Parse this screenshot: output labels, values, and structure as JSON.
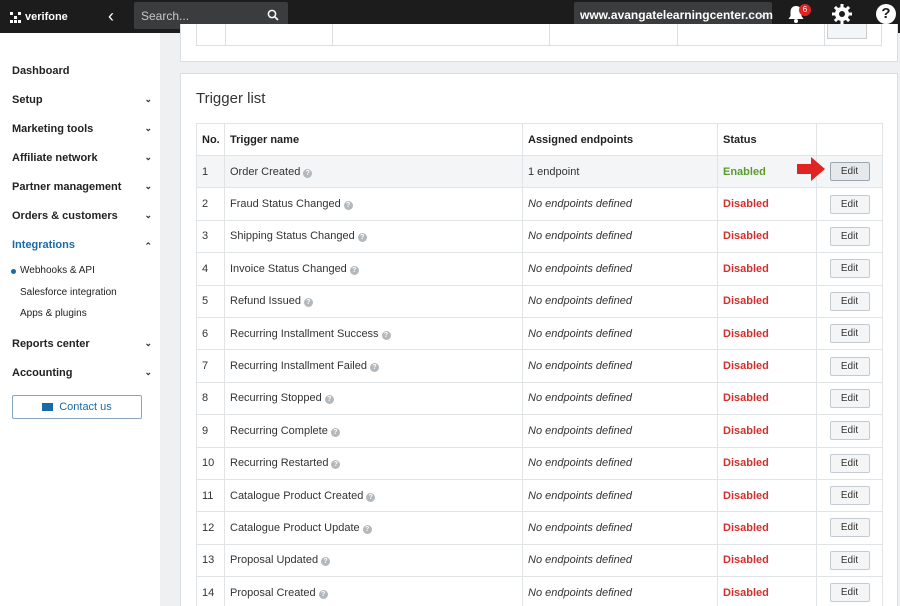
{
  "brand": {
    "name": "verifone"
  },
  "topbar": {
    "search_placeholder": "Search...",
    "account": "www.avangatelearningcenter.com",
    "notifications_count": "6"
  },
  "sidebar": {
    "items": [
      {
        "label": "Dashboard"
      },
      {
        "label": "Setup"
      },
      {
        "label": "Marketing tools"
      },
      {
        "label": "Affiliate network"
      },
      {
        "label": "Partner management"
      },
      {
        "label": "Orders & customers"
      },
      {
        "label": "Integrations"
      },
      {
        "label": "Reports center"
      },
      {
        "label": "Accounting"
      }
    ],
    "subitems": [
      {
        "label": "Webhooks & API"
      },
      {
        "label": "Salesforce integration"
      },
      {
        "label": "Apps & plugins"
      }
    ],
    "contact_label": "Contact us"
  },
  "panel": {
    "title": "Trigger list",
    "columns": [
      "No.",
      "Trigger name",
      "Assigned endpoints",
      "Status",
      ""
    ],
    "edit_label": "Edit",
    "rows": [
      {
        "no": "1",
        "name": "Order Created",
        "endpoints": "1 endpoint",
        "status": "Enabled"
      },
      {
        "no": "2",
        "name": "Fraud Status Changed",
        "endpoints": "No endpoints defined",
        "status": "Disabled"
      },
      {
        "no": "3",
        "name": "Shipping Status Changed",
        "endpoints": "No endpoints defined",
        "status": "Disabled"
      },
      {
        "no": "4",
        "name": "Invoice Status Changed",
        "endpoints": "No endpoints defined",
        "status": "Disabled"
      },
      {
        "no": "5",
        "name": "Refund Issued",
        "endpoints": "No endpoints defined",
        "status": "Disabled"
      },
      {
        "no": "6",
        "name": "Recurring Installment Success",
        "endpoints": "No endpoints defined",
        "status": "Disabled"
      },
      {
        "no": "7",
        "name": "Recurring Installment Failed",
        "endpoints": "No endpoints defined",
        "status": "Disabled"
      },
      {
        "no": "8",
        "name": "Recurring Stopped",
        "endpoints": "No endpoints defined",
        "status": "Disabled"
      },
      {
        "no": "9",
        "name": "Recurring Complete",
        "endpoints": "No endpoints defined",
        "status": "Disabled"
      },
      {
        "no": "10",
        "name": "Recurring Restarted",
        "endpoints": "No endpoints defined",
        "status": "Disabled"
      },
      {
        "no": "11",
        "name": "Catalogue Product Created",
        "endpoints": "No endpoints defined",
        "status": "Disabled"
      },
      {
        "no": "12",
        "name": "Catalogue Product Update",
        "endpoints": "No endpoints defined",
        "status": "Disabled"
      },
      {
        "no": "13",
        "name": "Proposal Updated",
        "endpoints": "No endpoints defined",
        "status": "Disabled"
      },
      {
        "no": "14",
        "name": "Proposal Created",
        "endpoints": "No endpoints defined",
        "status": "Disabled"
      }
    ]
  },
  "colors": {
    "enabled": "#5a9a2e",
    "disabled": "#d0312d",
    "accent": "#1b6aa8",
    "arrow": "#e02424"
  }
}
